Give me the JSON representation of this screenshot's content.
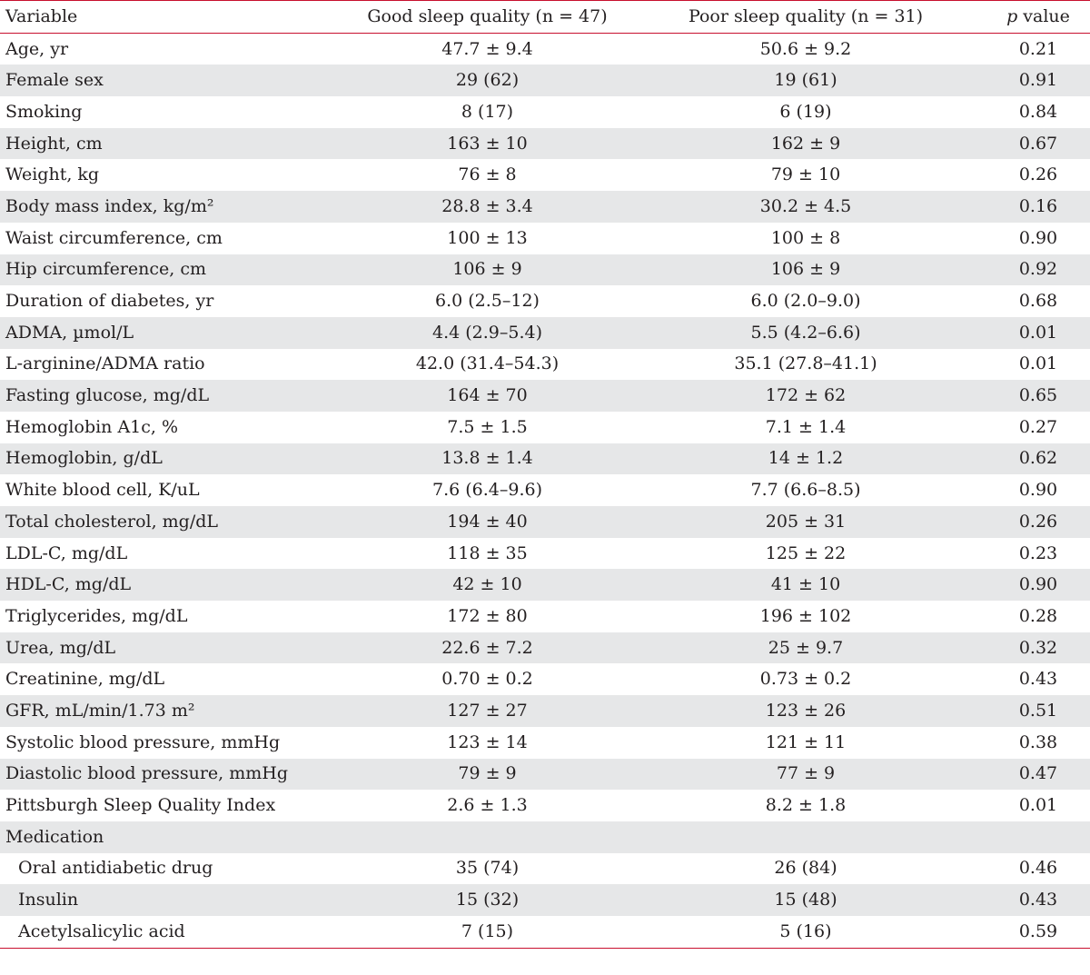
{
  "table": {
    "headers": {
      "variable": "Variable",
      "good": "Good sleep quality (n = 47)",
      "poor": "Poor sleep quality (n = 31)",
      "p_letter": "p",
      "p_rest": " value"
    },
    "rows": [
      {
        "variable": "Age, yr",
        "good": "47.7 ± 9.4",
        "poor": "50.6 ± 9.2",
        "p": "0.21"
      },
      {
        "variable": "Female sex",
        "good": "29 (62)",
        "poor": "19 (61)",
        "p": "0.91"
      },
      {
        "variable": "Smoking",
        "good": "8 (17)",
        "poor": "6 (19)",
        "p": "0.84"
      },
      {
        "variable": "Height, cm",
        "good": "163 ± 10",
        "poor": "162 ± 9",
        "p": "0.67"
      },
      {
        "variable": "Weight, kg",
        "good": "76 ± 8",
        "poor": "79 ± 10",
        "p": "0.26"
      },
      {
        "variable": "Body mass index, kg/m²",
        "good": "28.8 ± 3.4",
        "poor": "30.2 ± 4.5",
        "p": "0.16"
      },
      {
        "variable": "Waist circumference, cm",
        "good": "100 ± 13",
        "poor": "100 ± 8",
        "p": "0.90"
      },
      {
        "variable": "Hip circumference, cm",
        "good": "106 ± 9",
        "poor": "106 ± 9",
        "p": "0.92"
      },
      {
        "variable": "Duration of diabetes, yr",
        "good": "6.0 (2.5–12)",
        "poor": "6.0 (2.0–9.0)",
        "p": "0.68"
      },
      {
        "variable": "ADMA, µmol/L",
        "good": "4.4 (2.9–5.4)",
        "poor": "5.5 (4.2–6.6)",
        "p": "0.01"
      },
      {
        "variable": "L-arginine/ADMA ratio",
        "good": "42.0 (31.4–54.3)",
        "poor": "35.1 (27.8–41.1)",
        "p": "0.01"
      },
      {
        "variable": "Fasting glucose, mg/dL",
        "good": "164 ± 70",
        "poor": "172 ± 62",
        "p": "0.65"
      },
      {
        "variable": "Hemoglobin A1c, %",
        "good": "7.5 ± 1.5",
        "poor": "7.1 ± 1.4",
        "p": "0.27"
      },
      {
        "variable": "Hemoglobin, g/dL",
        "good": "13.8 ± 1.4",
        "poor": "14 ± 1.2",
        "p": "0.62"
      },
      {
        "variable": "White blood cell, K/uL",
        "good": "7.6 (6.4–9.6)",
        "poor": "7.7 (6.6–8.5)",
        "p": "0.90"
      },
      {
        "variable": "Total cholesterol, mg/dL",
        "good": "194 ± 40",
        "poor": "205 ± 31",
        "p": "0.26"
      },
      {
        "variable": "LDL-C, mg/dL",
        "good": "118 ± 35",
        "poor": "125 ± 22",
        "p": "0.23"
      },
      {
        "variable": "HDL-C, mg/dL",
        "good": "42 ± 10",
        "poor": "41 ± 10",
        "p": "0.90"
      },
      {
        "variable": "Triglycerides, mg/dL",
        "good": "172 ± 80",
        "poor": "196 ± 102",
        "p": "0.28"
      },
      {
        "variable": "Urea, mg/dL",
        "good": "22.6 ± 7.2",
        "poor": "25 ± 9.7",
        "p": "0.32"
      },
      {
        "variable": "Creatinine, mg/dL",
        "good": "0.70 ± 0.2",
        "poor": "0.73 ± 0.2",
        "p": "0.43"
      },
      {
        "variable": "GFR, mL/min/1.73 m²",
        "good": "127 ± 27",
        "poor": "123 ± 26",
        "p": "0.51"
      },
      {
        "variable": "Systolic blood pressure, mmHg",
        "good": "123 ± 14",
        "poor": "121 ± 11",
        "p": "0.38"
      },
      {
        "variable": "Diastolic blood pressure, mmHg",
        "good": "79 ± 9",
        "poor": "77 ± 9",
        "p": "0.47"
      },
      {
        "variable": "Pittsburgh Sleep Quality Index",
        "good": "2.6 ± 1.3",
        "poor": "8.2 ± 1.8",
        "p": "0.01"
      },
      {
        "variable": "Medication",
        "good": "",
        "poor": "",
        "p": ""
      },
      {
        "variable": "Oral antidiabetic drug",
        "good": "35 (74)",
        "poor": "26 (84)",
        "p": "0.46"
      },
      {
        "variable": "Insulin",
        "good": "15 (32)",
        "poor": "15 (48)",
        "p": "0.43"
      },
      {
        "variable": "Acetylsalicylic acid",
        "good": "7 (15)",
        "poor": "5 (16)",
        "p": "0.59"
      }
    ]
  },
  "colors": {
    "rule": "#c8102e",
    "row_shade": "#e6e7e8",
    "text": "#231f20"
  }
}
